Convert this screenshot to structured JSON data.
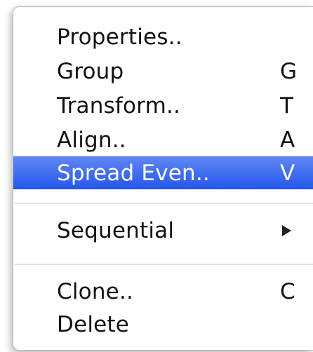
{
  "menu": {
    "items": [
      {
        "label": "Properties..",
        "shortcut": ""
      },
      {
        "label": "Group",
        "shortcut": "G"
      },
      {
        "label": "Transform..",
        "shortcut": "T"
      },
      {
        "label": "Align..",
        "shortcut": "A"
      },
      {
        "label": "Spread Even..",
        "shortcut": "V",
        "highlighted": true
      },
      {
        "label": "Sequential",
        "submenu": true
      },
      {
        "label": "Clone..",
        "shortcut": "C"
      },
      {
        "label": "Delete",
        "shortcut": ""
      }
    ],
    "highlight_color": "#2f5fef"
  }
}
